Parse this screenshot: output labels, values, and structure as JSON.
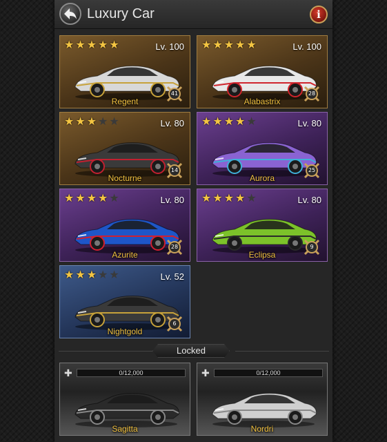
{
  "header": {
    "title": "Luxury Car",
    "info_label": "i"
  },
  "cars": [
    {
      "name": "Regent",
      "stars": 5,
      "level": "Lv. 100",
      "badge": "41",
      "body_color": "#d8d8d8",
      "accent": "#c7a23a"
    },
    {
      "name": "Alabastrix",
      "stars": 5,
      "level": "Lv. 100",
      "badge": "28",
      "body_color": "#e8e8e8",
      "accent": "#d0242c"
    },
    {
      "name": "Nocturne",
      "stars": 3,
      "level": "Lv. 80",
      "badge": "14",
      "body_color": "#3a3a3a",
      "accent": "#c22030"
    },
    {
      "name": "Aurora",
      "stars": 4,
      "level": "Lv. 80",
      "badge": "25",
      "body_color": "#8a63d2",
      "accent": "#3fb0d8"
    },
    {
      "name": "Azurite",
      "stars": 4,
      "level": "Lv. 80",
      "badge": "28",
      "body_color": "#1e56c8",
      "accent": "#d02030"
    },
    {
      "name": "Eclipsa",
      "stars": 4,
      "level": "Lv. 80",
      "badge": "9",
      "body_color": "#7cc22a",
      "accent": "#2a2a2a"
    },
    {
      "name": "Nightgold",
      "stars": 3,
      "level": "Lv. 52",
      "badge": "6",
      "body_color": "#3a3a3a",
      "accent": "#c7a23a"
    }
  ],
  "locked_label": "Locked",
  "locked_cars": [
    {
      "name": "Sagitta",
      "progress_text": "0/12,000",
      "progress": 0,
      "body_color": "#2a2a2a"
    },
    {
      "name": "Nordri",
      "progress_text": "0/12,000",
      "progress": 0,
      "body_color": "#cfcfcf"
    }
  ],
  "colors": {
    "star": "#f4c542",
    "name_text": "#f0c040"
  }
}
